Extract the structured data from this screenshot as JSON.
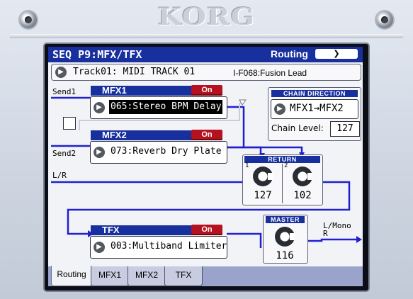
{
  "device": {
    "brand": "KORG"
  },
  "titlebar": {
    "title": "SEQ P9:MFX/TFX",
    "section": "Routing",
    "menu_icon": "chevron-down-icon"
  },
  "track": {
    "name": "Track01: MIDI TRACK 01",
    "program": "I-F068:Fusion Lead"
  },
  "labels": {
    "send1": "Send1",
    "send2": "Send2",
    "lr": "L/R",
    "l_mono": "L/Mono",
    "r": "R"
  },
  "mfx1": {
    "title": "MFX1",
    "switch": "On",
    "effect": "065:Stereo BPM Delay"
  },
  "mfx2": {
    "title": "MFX2",
    "switch": "On",
    "effect": "073:Reverb Dry Plate"
  },
  "tfx": {
    "title": "TFX",
    "switch": "On",
    "effect": "003:Multiband Limiter"
  },
  "chain": {
    "title": "CHAIN DIRECTION",
    "direction": "MFX1→MFX2",
    "level_label": "Chain Level:",
    "level": "127"
  },
  "return": {
    "title": "RETURN",
    "ch1": "1",
    "ch2": "2",
    "value1": "127",
    "value2": "102"
  },
  "master": {
    "title": "MASTER",
    "value": "116"
  },
  "tabs": [
    {
      "label": "Routing",
      "active": true
    },
    {
      "label": "MFX1",
      "active": false
    },
    {
      "label": "MFX2",
      "active": false
    },
    {
      "label": "TFX",
      "active": false
    }
  ],
  "colors": {
    "header": "#182f9e",
    "wire": "#2020d0",
    "on_button": "#b5111f"
  }
}
